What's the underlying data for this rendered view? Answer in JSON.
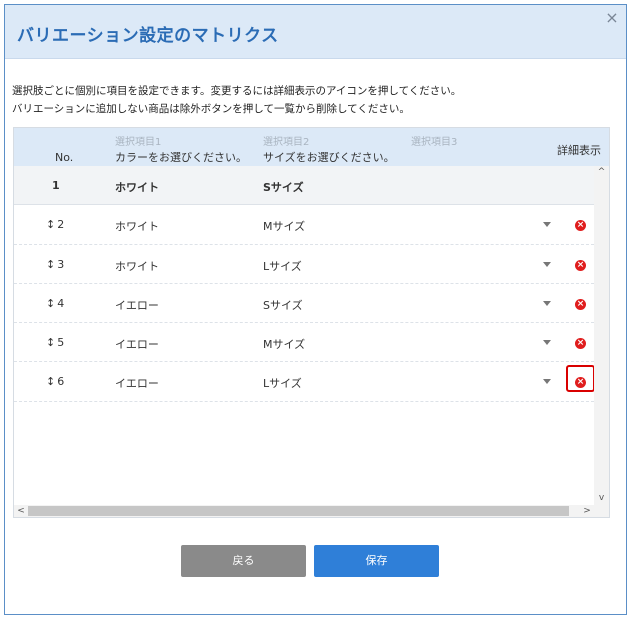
{
  "dialog": {
    "title": "バリエーション設定のマトリクス",
    "close_glyph": "×"
  },
  "description": [
    "選択肢ごとに個別に項目を設定できます。変更するには詳細表示のアイコンを押してください。",
    "バリエーションに追加しない商品は除外ボタンを押して一覧から削除してください。"
  ],
  "table": {
    "headers": {
      "no": "No.",
      "option1_label": "選択項目1",
      "option1_value": "カラーをお選びください。",
      "option2_label": "選択項目2",
      "option2_value": "サイズをお選びください。",
      "option3_label": "選択項目3",
      "detail": "詳細表示"
    },
    "rows": [
      {
        "no": "1",
        "color": "ホワイト",
        "size": "Sサイズ"
      },
      {
        "no": "2",
        "color": "ホワイト",
        "size": "Mサイズ"
      },
      {
        "no": "3",
        "color": "ホワイト",
        "size": "Lサイズ"
      },
      {
        "no": "4",
        "color": "イエロー",
        "size": "Sサイズ"
      },
      {
        "no": "5",
        "color": "イエロー",
        "size": "Mサイズ"
      },
      {
        "no": "6",
        "color": "イエロー",
        "size": "Lサイズ"
      }
    ]
  },
  "icons": {
    "drag": "updown-arrow-icon",
    "dropdown": "caret-down-icon",
    "remove": "remove-circle-icon"
  },
  "colors": {
    "accent": "#2f7fd8",
    "header_bg": "#dce9f7",
    "remove": "#e01d1d",
    "highlight": "#d90000"
  },
  "buttons": {
    "back": "戻る",
    "save": "保存"
  },
  "scroll_glyphs": {
    "up": "^",
    "down": "v",
    "left": "<",
    "right": ">"
  }
}
